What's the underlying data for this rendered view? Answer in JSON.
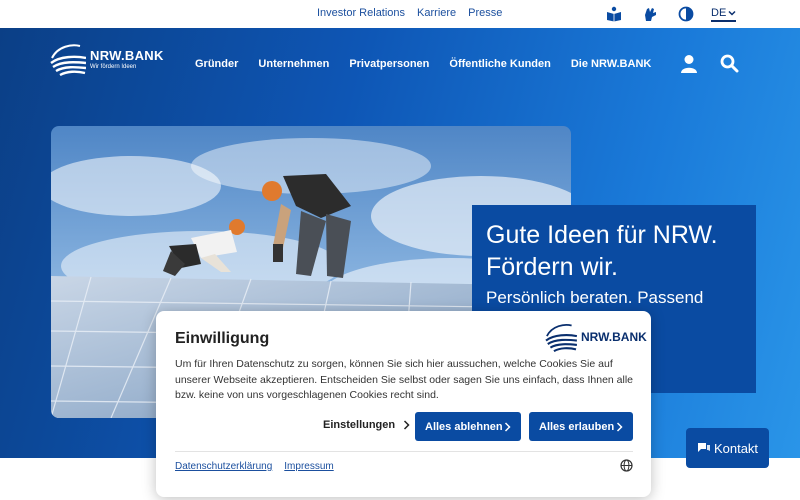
{
  "utility_nav": {
    "links": [
      "Investor Relations",
      "Karriere",
      "Presse"
    ],
    "icons": [
      "easy-language-icon",
      "sign-language-icon",
      "contrast-icon"
    ],
    "language": "DE"
  },
  "header": {
    "logo_name": "NRW.BANK",
    "logo_tagline": "Wir fördern Ideen",
    "nav": [
      "Gründer",
      "Unternehmen",
      "Privatpersonen",
      "Öffentliche Kunden",
      "Die NRW.BANK"
    ],
    "icons": [
      "user-icon",
      "search-icon"
    ]
  },
  "hero": {
    "claim_title": "Gute Ideen für NRW. Fördern wir.",
    "claim_sub": "Persönlich beraten. Passend"
  },
  "consent": {
    "title": "Einwilligung",
    "logo_name": "NRW.BANK",
    "text": "Um für Ihren Datenschutz zu sorgen, können Sie sich hier aussuchen, welche Cookies Sie auf unserer Webseite akzeptieren. Entscheiden Sie selbst oder sagen Sie uns einfach, dass Ihnen alle bzw. keine von uns vorgeschlagenen Cookies recht sind.",
    "settings_label": "Einstellungen",
    "reject_label": "Alles ablehnen",
    "accept_label": "Alles erlauben",
    "privacy_link": "Datenschutzerklärung",
    "imprint_link": "Impressum"
  },
  "contact": {
    "label": "Kontakt"
  },
  "colors": {
    "brand": "#0a4ba2",
    "dark": "#0a2f6e",
    "accent_light": "#2a95e8"
  }
}
